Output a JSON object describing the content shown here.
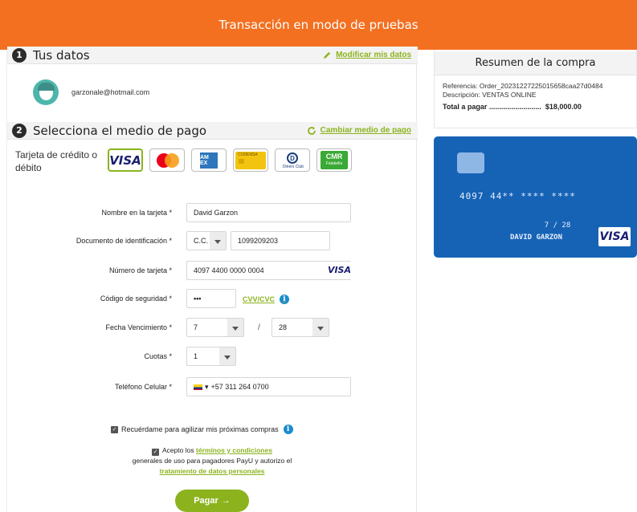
{
  "banner": {
    "text": "Transacción en modo de pruebas"
  },
  "step1": {
    "number": "1",
    "title": "Tus datos",
    "link": "Modificar mis datos"
  },
  "user": {
    "email": "garzonale@hotmail.com"
  },
  "step2": {
    "number": "2",
    "title": "Selecciona el medio de pago",
    "link": "Cambiar medio de pago"
  },
  "payment_methods": {
    "label": "Tarjeta de crédito o débito",
    "cards": [
      {
        "name": "visa",
        "text": "VISA",
        "selected": true
      },
      {
        "name": "mastercard",
        "text": "",
        "selected": false
      },
      {
        "name": "amex",
        "text": "AM EX",
        "selected": false
      },
      {
        "name": "codensa",
        "text": "CODENSA",
        "selected": false
      },
      {
        "name": "diners",
        "text": "Diners Club",
        "selected": false
      },
      {
        "name": "cmr",
        "text": "CMR",
        "sub": "Falabella",
        "selected": false
      }
    ]
  },
  "form": {
    "name_label": "Nombre en la tarjeta *",
    "name_value": "David Garzon",
    "doc_label": "Documento de identificación *",
    "doc_type": "C.C.",
    "doc_number": "1099209203",
    "card_label": "Número de tarjeta *",
    "card_value": "4097 4400 0000 0004",
    "card_brand": "VISA",
    "cvv_label": "Código de seguridad *",
    "cvv_value": "•••",
    "cvv_link": "CVV/CVC",
    "exp_label": "Fecha Vencimiento *",
    "exp_month": "7",
    "exp_sep": "/",
    "exp_year": "28",
    "cuotas_label": "Cuotas *",
    "cuotas_value": "1",
    "phone_label": "Teléfono Celular *",
    "phone_value": "+57 311 264 0700"
  },
  "remember": {
    "text": "Recuérdame para agilizar mis próximas compras"
  },
  "terms": {
    "prefix": "Acepto los",
    "link1": "términos y condiciones",
    "middle": "generales de uso para pagadores PayU y autorizo el",
    "link2": "tratamiento de datos personales"
  },
  "pay_button": {
    "label": "Pagar",
    "arrow": "→"
  },
  "summary": {
    "title": "Resumen de la compra",
    "reference": "Referencia: Order_20231227225015658caa27d0484",
    "description": "Descripción: VENTAS ONLINE",
    "total_label": "Total a pagar ..........................",
    "total_amount": "$18,000.00"
  },
  "card_preview": {
    "number": "4097 44** **** ****",
    "exp": "7 / 28",
    "holder": "DAVID GARZON",
    "brand": "VISA",
    "color": "#1663b6"
  },
  "colors": {
    "accent": "#8cb31e",
    "banner": "#f37021",
    "info": "#1a8ccf"
  }
}
